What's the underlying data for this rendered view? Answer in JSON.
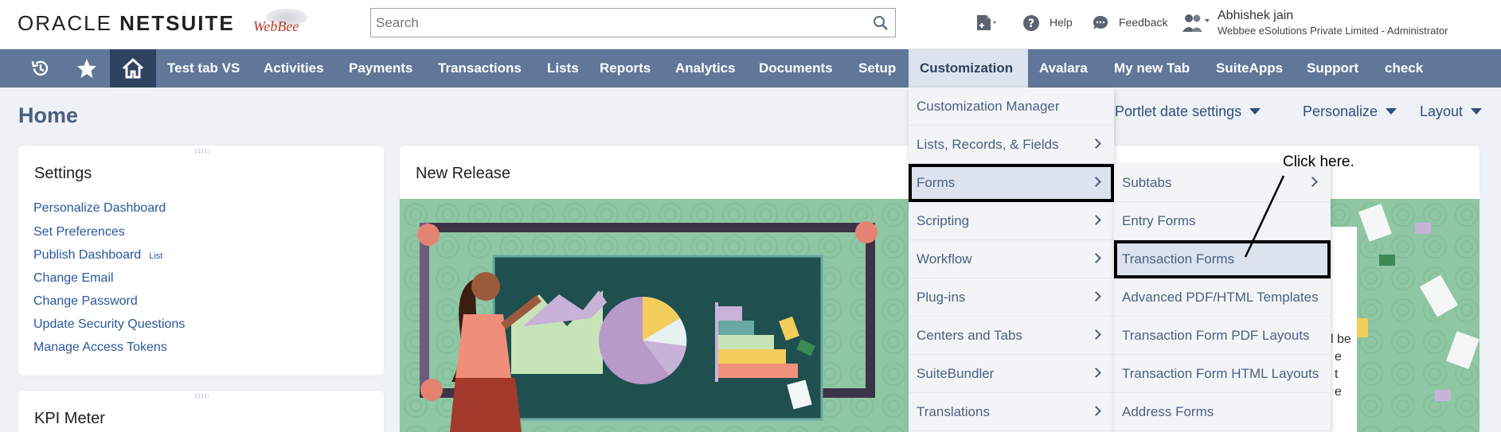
{
  "header": {
    "logo_oracle": "ORACLE",
    "logo_netsuite": "NETSUITE",
    "logo_webbee": "WebBee",
    "search_placeholder": "Search",
    "help": "Help",
    "feedback": "Feedback",
    "user_name": "Abhishek jain",
    "user_role": "Webbee eSolutions Private Limited - Administrator"
  },
  "nav": {
    "items": [
      "Test tab VS",
      "Activities",
      "Payments",
      "Transactions",
      "Lists",
      "Reports",
      "Analytics",
      "Documents",
      "Setup",
      "Customization",
      "Avalara",
      "My new Tab",
      "SuiteApps",
      "Support",
      "check"
    ],
    "active": "Customization"
  },
  "page": {
    "title": "Home",
    "toolbar": {
      "settings": "g: Portlet date settings",
      "personalize": "Personalize",
      "layout": "Layout"
    }
  },
  "settings_portlet": {
    "title": "Settings",
    "links": [
      "Personalize Dashboard",
      "Set Preferences",
      "Publish Dashboard",
      "Change Email",
      "Change Password",
      "Update Security Questions",
      "Manage Access Tokens"
    ],
    "publish_sub": "List"
  },
  "kpi_portlet": {
    "title": "KPI Meter"
  },
  "release_portlet": {
    "title": "New Release",
    "snippets": [
      "l be",
      "e",
      "t",
      "e"
    ]
  },
  "customization_menu": {
    "items": [
      {
        "label": "Customization Manager",
        "has_sub": false
      },
      {
        "label": "Lists, Records, & Fields",
        "has_sub": true
      },
      {
        "label": "Forms",
        "has_sub": true
      },
      {
        "label": "Scripting",
        "has_sub": true
      },
      {
        "label": "Workflow",
        "has_sub": true
      },
      {
        "label": "Plug-ins",
        "has_sub": true
      },
      {
        "label": "Centers and Tabs",
        "has_sub": true
      },
      {
        "label": "SuiteBundler",
        "has_sub": true
      },
      {
        "label": "Translations",
        "has_sub": true
      }
    ]
  },
  "forms_submenu": {
    "items": [
      {
        "label": "Subtabs",
        "has_sub": true
      },
      {
        "label": "Entry Forms",
        "has_sub": false
      },
      {
        "label": "Transaction Forms",
        "has_sub": false
      },
      {
        "label": "Advanced PDF/HTML Templates",
        "has_sub": false
      },
      {
        "label": "Transaction Form PDF Layouts",
        "has_sub": false
      },
      {
        "label": "Transaction Form HTML Layouts",
        "has_sub": false
      },
      {
        "label": "Address Forms",
        "has_sub": false
      }
    ]
  },
  "annotation": {
    "text": "Click here."
  },
  "colors": {
    "nav_bg": "#607799",
    "nav_active_bg": "#dce3ee",
    "link": "#2b579a",
    "highlight_box": "#000000"
  }
}
